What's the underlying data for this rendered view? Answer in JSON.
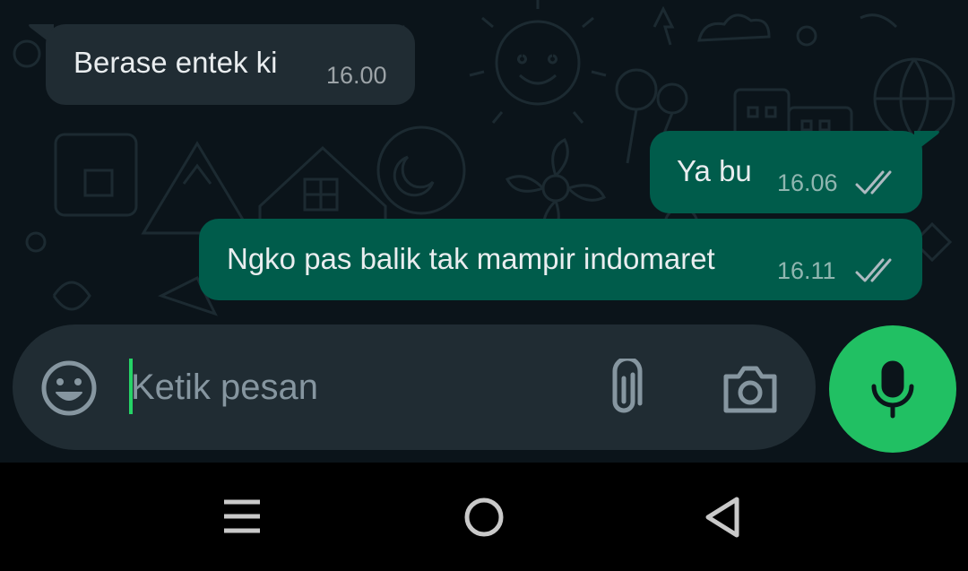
{
  "messages": [
    {
      "direction": "incoming",
      "text": "Berase entek ki",
      "time": "16.00"
    },
    {
      "direction": "outgoing",
      "text": "Ya bu",
      "time": "16.06",
      "status": "read-double-check-icon"
    },
    {
      "direction": "outgoing",
      "text": "Ngko pas balik tak mampir indomaret",
      "time": "16.11",
      "status": "read-double-check-icon"
    }
  ],
  "input": {
    "placeholder": "Ketik pesan"
  },
  "colors": {
    "background": "#0b141a",
    "incoming_bubble": "#202c33",
    "outgoing_bubble": "#005c4b",
    "accent": "#25d366"
  },
  "icons": {
    "emoji": "emoji-icon",
    "attach": "paperclip-icon",
    "camera": "camera-icon",
    "mic": "microphone-icon",
    "nav": [
      "menu-icon",
      "home-icon",
      "back-icon"
    ]
  }
}
